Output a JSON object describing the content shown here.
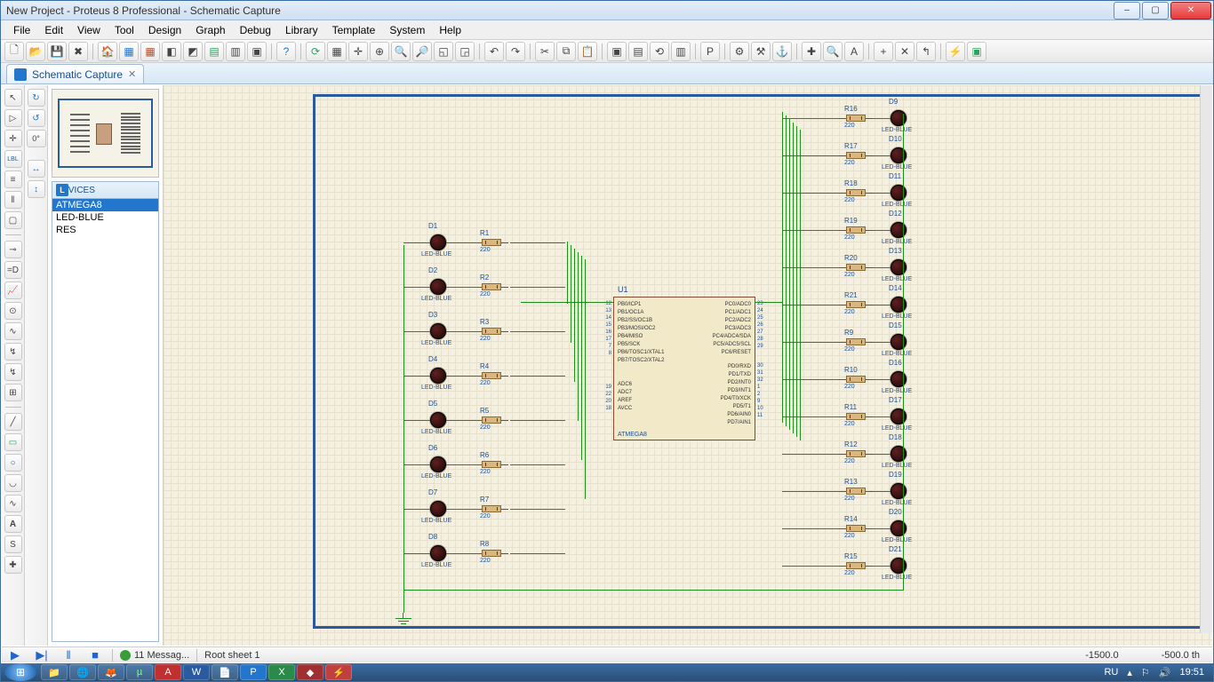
{
  "window": {
    "title": "New Project - Proteus 8 Professional - Schematic Capture"
  },
  "menu": [
    "File",
    "Edit",
    "View",
    "Tool",
    "Design",
    "Graph",
    "Debug",
    "Library",
    "Template",
    "System",
    "Help"
  ],
  "tab": {
    "label": "Schematic Capture"
  },
  "devices_header": "DEVICES",
  "devices": [
    "ATMEGA8",
    "LED-BLUE",
    "RES"
  ],
  "device_selected": 0,
  "angle": "0°",
  "status": {
    "messages": "11 Messag...",
    "sheet": "Root sheet 1",
    "coord1": "-1500.0",
    "coord2": "-500.0   th"
  },
  "taskbar": {
    "lang": "RU",
    "time": "19:51"
  },
  "chip": {
    "ref": "U1",
    "val": "ATMEGA8",
    "left_pins": [
      "PB0/ICP1",
      "PB1/OC1A",
      "PB2/SS/OC1B",
      "PB3/MOSI/OC2",
      "PB4/MISO",
      "PB5/SCK",
      "PB6/TOSC1/XTAL1",
      "PB7/TOSC2/XTAL2"
    ],
    "left_nums": [
      "12",
      "13",
      "14",
      "15",
      "16",
      "17",
      "7",
      "8"
    ],
    "right_pins": [
      "PC0/ADC0",
      "PC1/ADC1",
      "PC2/ADC2",
      "PC3/ADC3",
      "PC4/ADC4/SDA",
      "PC5/ADC5/SCL",
      "PC6/RESET"
    ],
    "right_nums": [
      "23",
      "24",
      "25",
      "26",
      "27",
      "28",
      "29"
    ],
    "right2_pins": [
      "PD0/RXD",
      "PD1/TXD",
      "PD2/INT0",
      "PD3/INT1",
      "PD4/T0/XCK",
      "PD5/T1",
      "PD6/AIN0",
      "PD7/AIN1"
    ],
    "right2_nums": [
      "30",
      "31",
      "32",
      "1",
      "2",
      "9",
      "10",
      "11"
    ],
    "left2_pins": [
      "ADC6",
      "ADC7",
      "AREF",
      "AVCC"
    ],
    "left2_nums": [
      "19",
      "22",
      "20",
      "18"
    ]
  },
  "left_leds": [
    {
      "d": "D1",
      "r": "R1"
    },
    {
      "d": "D2",
      "r": "R2"
    },
    {
      "d": "D3",
      "r": "R3"
    },
    {
      "d": "D4",
      "r": "R4"
    },
    {
      "d": "D5",
      "r": "R5"
    },
    {
      "d": "D6",
      "r": "R6"
    },
    {
      "d": "D7",
      "r": "R7"
    },
    {
      "d": "D8",
      "r": "R8"
    }
  ],
  "right_leds": [
    {
      "d": "D9",
      "r": "R16"
    },
    {
      "d": "D10",
      "r": "R17"
    },
    {
      "d": "D11",
      "r": "R18"
    },
    {
      "d": "D12",
      "r": "R19"
    },
    {
      "d": "D13",
      "r": "R20"
    },
    {
      "d": "D14",
      "r": "R21"
    },
    {
      "d": "D15",
      "r": "R9"
    },
    {
      "d": "D16",
      "r": "R10"
    },
    {
      "d": "D17",
      "r": "R11"
    },
    {
      "d": "D18",
      "r": "R12"
    },
    {
      "d": "D19",
      "r": "R13"
    },
    {
      "d": "D20",
      "r": "R14"
    },
    {
      "d": "D21",
      "r": "R15"
    }
  ],
  "led_value": "LED-BLUE",
  "res_value": "220"
}
